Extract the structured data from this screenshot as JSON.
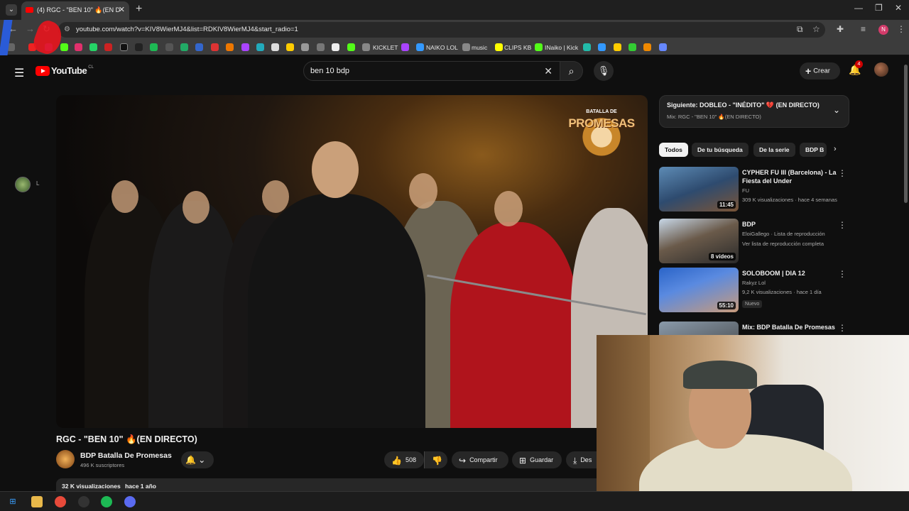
{
  "browser": {
    "tab_title": "(4) RGC - \"BEN 10\" 🔥(EN D",
    "tab_close": "✕",
    "new_tab": "+",
    "url": "youtube.com/watch?v=KIV8WierMJ4&list=RDKIV8WierMJ4&start_radio=1",
    "profile_initial": "N"
  },
  "bookmarks": [
    "KICKLET",
    "NAIKO LOL",
    "music",
    "CLIPS KB",
    "INaiko | Kick"
  ],
  "youtube": {
    "logo_text": "YouTube",
    "country": "CL",
    "search_value": "ben 10 bdp",
    "create_label": "Crear",
    "notif_count": "4"
  },
  "video": {
    "overlay_logo_top": "BATALLA DE",
    "overlay_logo_main": "PROMESAS",
    "title": "RGC - \"BEN 10\" 🔥(EN DIRECTO)",
    "channel": "BDP Batalla De Promesas",
    "subscribers": "496 K suscriptores",
    "likes": "508",
    "share_label": "Compartir",
    "save_label": "Guardar",
    "download_label": "Des",
    "views": "32 K visualizaciones",
    "date": "hace 1 año"
  },
  "playlist": {
    "next": "Siguiente: DOBLEO - \"INÉDITO\" 💔 (EN DIRECTO)",
    "mix": "Mix: RGC - \"BEN 10\" 🔥(EN DIRECTO)"
  },
  "chips": [
    "Todos",
    "De tu búsqueda",
    "De la serie",
    "BDP B"
  ],
  "recommendations": [
    {
      "title": "CYPHER FU III (Barcelona) - La Fiesta del Under",
      "channel": "FU",
      "meta": "309 K visualizaciones · hace 4 semanas",
      "duration": "11:45"
    },
    {
      "title": "BDP",
      "channel": "EloiGallego · Lista de reproducción",
      "meta": "Ver lista de reproducción completa",
      "duration": "8 vídeos"
    },
    {
      "title": "SOLOBOOM | DIA 12",
      "channel": "Rakyz Lol",
      "meta": "9,2 K visualizaciones · hace 1 día",
      "duration": "55:10",
      "badge": "Nuevo"
    },
    {
      "title": "Mix: BDP Batalla De Promesas",
      "channel": "",
      "meta": "",
      "duration": ""
    }
  ],
  "colors": {
    "yt_red": "#ff0000",
    "bg": "#0f0f0f",
    "chip_bg": "#272727"
  }
}
